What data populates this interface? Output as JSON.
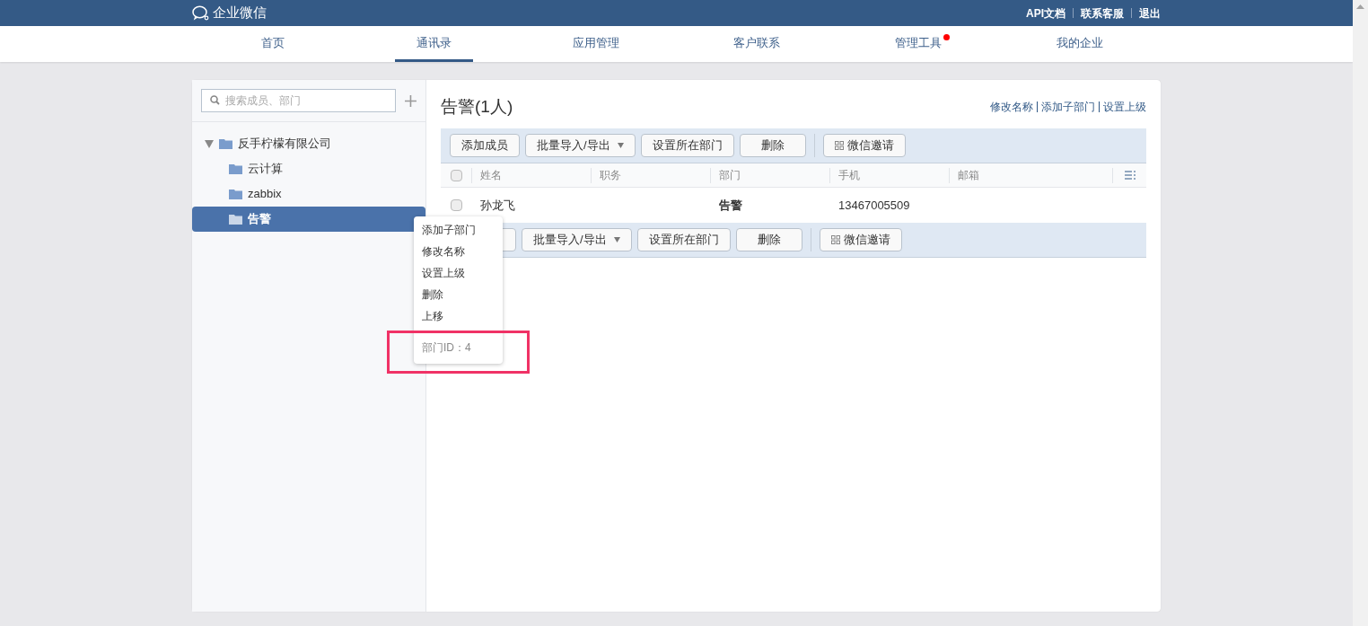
{
  "header": {
    "logo": "企业微信",
    "links": [
      "API文档",
      "联系客服",
      "退出"
    ]
  },
  "nav": [
    {
      "label": "首页",
      "selected": false,
      "badge": false
    },
    {
      "label": "通讯录",
      "selected": true,
      "badge": false
    },
    {
      "label": "应用管理",
      "selected": false,
      "badge": false
    },
    {
      "label": "客户联系",
      "selected": false,
      "badge": false
    },
    {
      "label": "管理工具",
      "selected": false,
      "badge": true
    },
    {
      "label": "我的企业",
      "selected": false,
      "badge": false
    }
  ],
  "sidebar": {
    "search": {
      "placeholder": "搜索成员、部门"
    },
    "tree": [
      {
        "label": "反手柠檬有限公司",
        "expanded": true,
        "selected": false,
        "children": [
          {
            "label": "云计算",
            "selected": false
          },
          {
            "label": "zabbix",
            "selected": false
          },
          {
            "label": "告警",
            "selected": true
          }
        ]
      }
    ]
  },
  "context_menu": {
    "items": [
      "添加子部门",
      "修改名称",
      "设置上级",
      "删除",
      "上移"
    ],
    "footer": "部门ID：4"
  },
  "main": {
    "title": "告警(1人)",
    "links": [
      "修改名称",
      "添加子部门",
      "设置上级"
    ],
    "toolbar": [
      {
        "label": "添加成员",
        "kind": "plain"
      },
      {
        "label": "批量导入/导出",
        "kind": "dropdown"
      },
      {
        "label": "设置所在部门",
        "kind": "plain"
      },
      {
        "label": "删除",
        "kind": "plain"
      },
      {
        "label": "微信邀请",
        "kind": "qr"
      }
    ],
    "bottom_toolbar": [
      {
        "kind": "plain"
      },
      {
        "label": "批量导入/导出",
        "kind": "dropdown"
      },
      {
        "label": "设置所在部门",
        "kind": "plain"
      },
      {
        "label": "删除",
        "kind": "plain"
      },
      {
        "label": "微信邀请",
        "kind": "qr"
      }
    ],
    "table": {
      "select_all_checked": false,
      "columns": [
        "姓名",
        "职务",
        "部门",
        "手机",
        "邮箱"
      ],
      "rows": [
        {
          "checked": false,
          "cells": [
            "孙龙飞",
            "",
            "告警",
            "13467005509",
            ""
          ]
        }
      ]
    }
  }
}
